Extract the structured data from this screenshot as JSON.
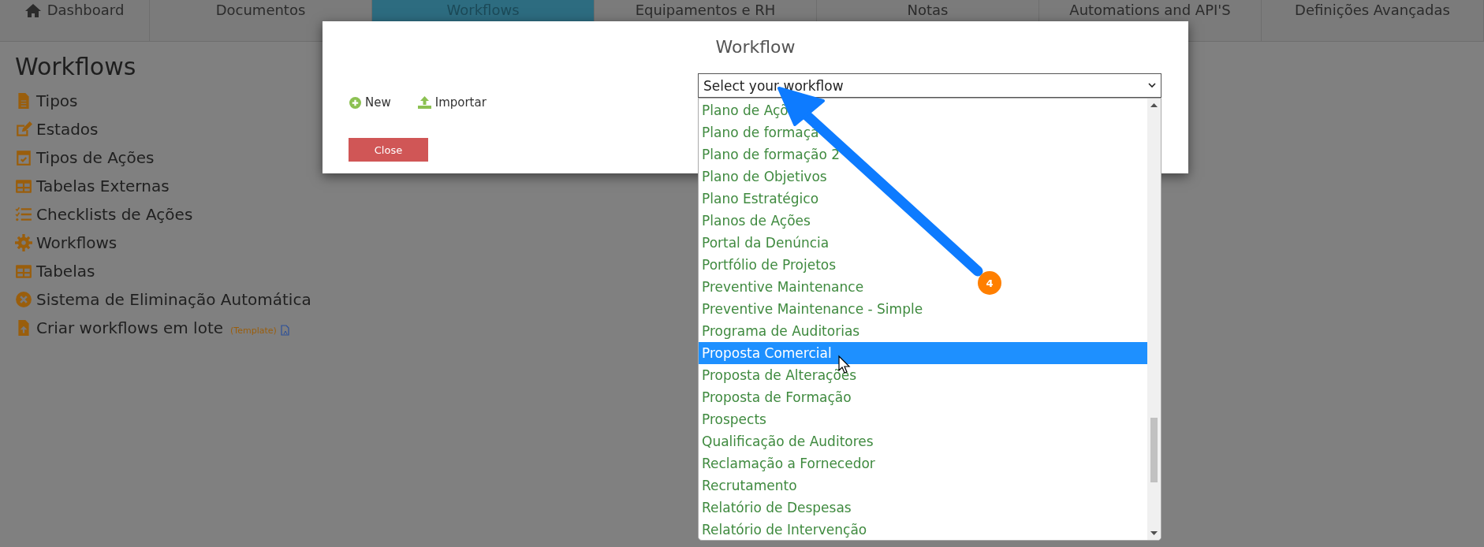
{
  "nav": {
    "tabs": [
      {
        "label": "Dashboard",
        "kind": "home",
        "selected": false
      },
      {
        "label": "Documentos",
        "selected": false
      },
      {
        "label": "Workflows",
        "selected": true
      },
      {
        "label": "Equipamentos e RH",
        "selected": false
      },
      {
        "label": "Notas",
        "selected": false
      },
      {
        "label": "Automations and API'S",
        "selected": false
      },
      {
        "label": "Definições Avançadas",
        "selected": false
      }
    ]
  },
  "sidebar": {
    "title": "Workflows",
    "items": [
      {
        "label": "Tipos",
        "kind": "file"
      },
      {
        "label": "Estados",
        "kind": "edit"
      },
      {
        "label": "Tipos de Ações",
        "kind": "calendar"
      },
      {
        "label": "Tabelas Externas",
        "kind": "table"
      },
      {
        "label": "Checklists de Ações",
        "kind": "checklist"
      },
      {
        "label": "Workflows",
        "kind": "gear"
      },
      {
        "label": "Tabelas",
        "kind": "table"
      },
      {
        "label": "Sistema de Eliminação Automática",
        "kind": "times"
      },
      {
        "label": "Criar workflows em lote",
        "kind": "upload",
        "link": "(Template)"
      }
    ]
  },
  "modal": {
    "title": "Workflow",
    "actions": [
      {
        "label": "New",
        "kind": "new"
      },
      {
        "label": "Importar",
        "kind": "import"
      }
    ],
    "select": {
      "placeholder": "Select your workflow"
    },
    "close": "Close"
  },
  "dropdown": {
    "options": [
      {
        "label": "Plano de Açõ",
        "selected": false
      },
      {
        "label": "Plano de formaçã",
        "selected": false
      },
      {
        "label": "Plano de formação 2",
        "selected": false
      },
      {
        "label": "Plano de Objetivos",
        "selected": false
      },
      {
        "label": "Plano Estratégico",
        "selected": false
      },
      {
        "label": "Planos de Ações",
        "selected": false
      },
      {
        "label": "Portal da Denúncia",
        "selected": false
      },
      {
        "label": "Portfólio de Projetos",
        "selected": false
      },
      {
        "label": "Preventive Maintenance",
        "selected": false
      },
      {
        "label": "Preventive Maintenance - Simple",
        "selected": false
      },
      {
        "label": "Programa de Auditorias",
        "selected": false
      },
      {
        "label": "Proposta Comercial",
        "selected": true
      },
      {
        "label": "Proposta de Alterações",
        "selected": false
      },
      {
        "label": "Proposta de Formação",
        "selected": false
      },
      {
        "label": "Prospects",
        "selected": false
      },
      {
        "label": "Qualificação de Auditores",
        "selected": false
      },
      {
        "label": "Reclamação a Fornecedor",
        "selected": false
      },
      {
        "label": "Recrutamento",
        "selected": false
      },
      {
        "label": "Relatório de Despesas",
        "selected": false
      },
      {
        "label": "Relatório de Intervenção",
        "selected": false
      }
    ]
  },
  "annotation": {
    "badge": "4"
  }
}
